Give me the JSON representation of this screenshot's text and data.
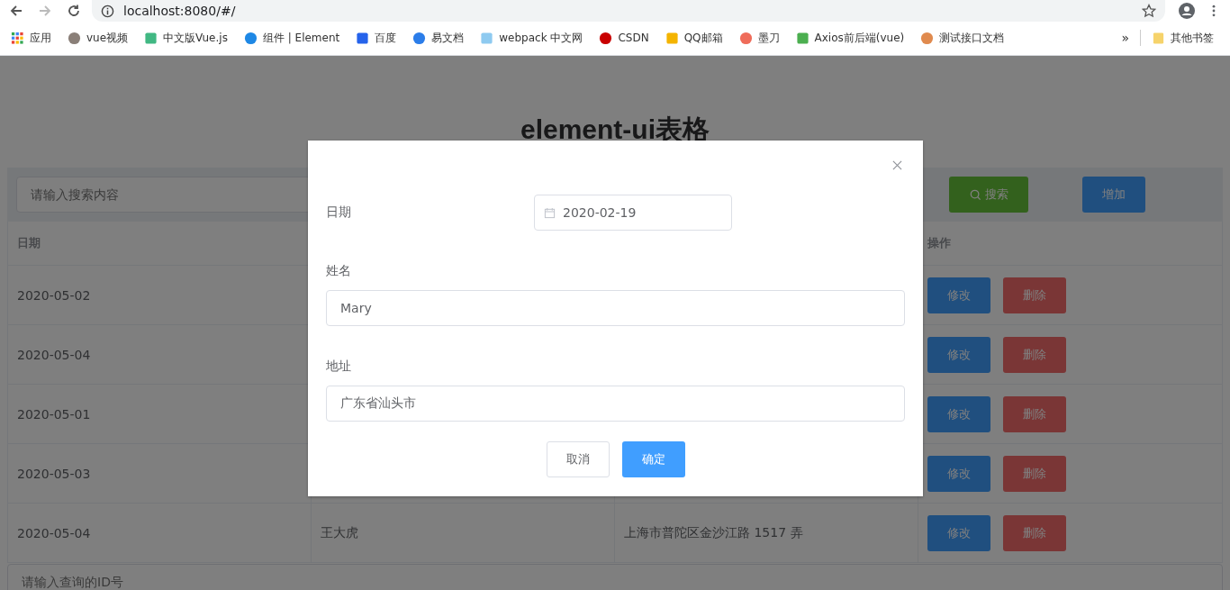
{
  "browser": {
    "address": "localhost:8080/#/",
    "bookmarks": [
      {
        "label": "应用"
      },
      {
        "label": "vue视频"
      },
      {
        "label": "中文版Vue.js"
      },
      {
        "label": "组件 | Element"
      },
      {
        "label": "百度"
      },
      {
        "label": "易文档"
      },
      {
        "label": "webpack 中文网"
      },
      {
        "label": "CSDN"
      },
      {
        "label": "QQ邮箱"
      },
      {
        "label": "墨刀"
      },
      {
        "label": "Axios前后端(vue)"
      },
      {
        "label": "测试接口文档"
      }
    ],
    "more": "»",
    "other_bookmarks": "其他书签"
  },
  "page": {
    "title": "element-ui表格",
    "toolbar": {
      "search_placeholder": "请输入搜索内容",
      "search_button": "搜索",
      "add_button": "增加"
    },
    "table": {
      "header": {
        "date": "日期",
        "actions": "操作"
      },
      "rows": [
        {
          "date": "2020-05-02",
          "edit": "修改",
          "delete": "删除"
        },
        {
          "date": "2020-05-04",
          "edit": "修改",
          "delete": "删除"
        },
        {
          "date": "2020-05-01",
          "edit": "修改",
          "delete": "删除"
        },
        {
          "date": "2020-05-03",
          "edit": "修改",
          "delete": "删除"
        },
        {
          "date": "2020-05-04",
          "name": "王大虎",
          "address": "上海市普陀区金沙江路 1517 弄",
          "edit": "修改",
          "delete": "删除"
        }
      ]
    },
    "id_placeholder": "请输入查询的ID号"
  },
  "dialog": {
    "date_label": "日期",
    "date_value": "2020-02-19",
    "name_label": "姓名",
    "name_value": "Mary",
    "address_label": "地址",
    "address_value": "广东省汕头市",
    "cancel": "取消",
    "confirm": "确定"
  }
}
